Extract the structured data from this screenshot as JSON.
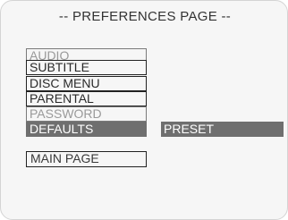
{
  "page": {
    "title": "-- PREFERENCES PAGE --"
  },
  "menu": {
    "items": [
      {
        "label": "AUDIO"
      },
      {
        "label": "SUBTITLE"
      },
      {
        "label": "DISC MENU"
      },
      {
        "label": "PARENTAL"
      },
      {
        "label": "PASSWORD"
      },
      {
        "label": "DEFAULTS"
      }
    ],
    "selected_item": "DEFAULTS",
    "main_page_label": "MAIN PAGE"
  },
  "options": {
    "selected_label": "PRESET"
  },
  "colors": {
    "highlight": "#6f6f6f",
    "text": "#333333",
    "dim_text": "#9a9a9a"
  }
}
